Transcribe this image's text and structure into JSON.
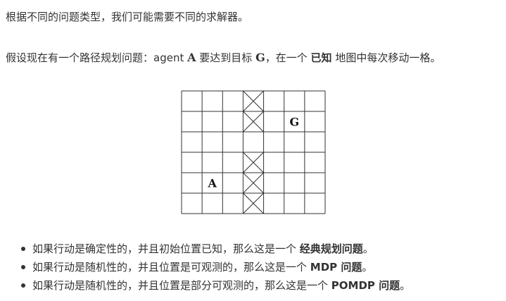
{
  "intro": {
    "line": "根据不同的问题类型，我们可能需要不同的求解器。"
  },
  "problem": {
    "prefix": "假设现在有一个路径规划问题：agent ",
    "agent_symbol": "A",
    "middle": " 要达到目标 ",
    "goal_symbol": "G",
    "suffix1": "，在一个 ",
    "known_word": "已知",
    "suffix2": " 地图中每次移动一格。"
  },
  "grid": {
    "rows": 6,
    "cols": 7,
    "line_color": "#333333",
    "blocked_cells": [
      [
        0,
        3
      ],
      [
        1,
        3
      ],
      [
        3,
        3
      ],
      [
        4,
        3
      ],
      [
        5,
        3
      ]
    ],
    "labels": [
      {
        "row": 1,
        "col": 5,
        "text": "G"
      },
      {
        "row": 4,
        "col": 1,
        "text": "A"
      }
    ]
  },
  "bullets": [
    {
      "text": "如果行动是确定性的，并且初始位置已知，那么这是一个 ",
      "bold": "经典规划问题",
      "end": "。"
    },
    {
      "text": "如果行动是随机性的，并且位置是可观测的，那么这是一个 ",
      "bold": "MDP 问题",
      "end": "。"
    },
    {
      "text": "如果行动是随机性的，并且位置是部分可观测的，那么这是一个 ",
      "bold": "POMDP 问题",
      "end": "。"
    }
  ]
}
